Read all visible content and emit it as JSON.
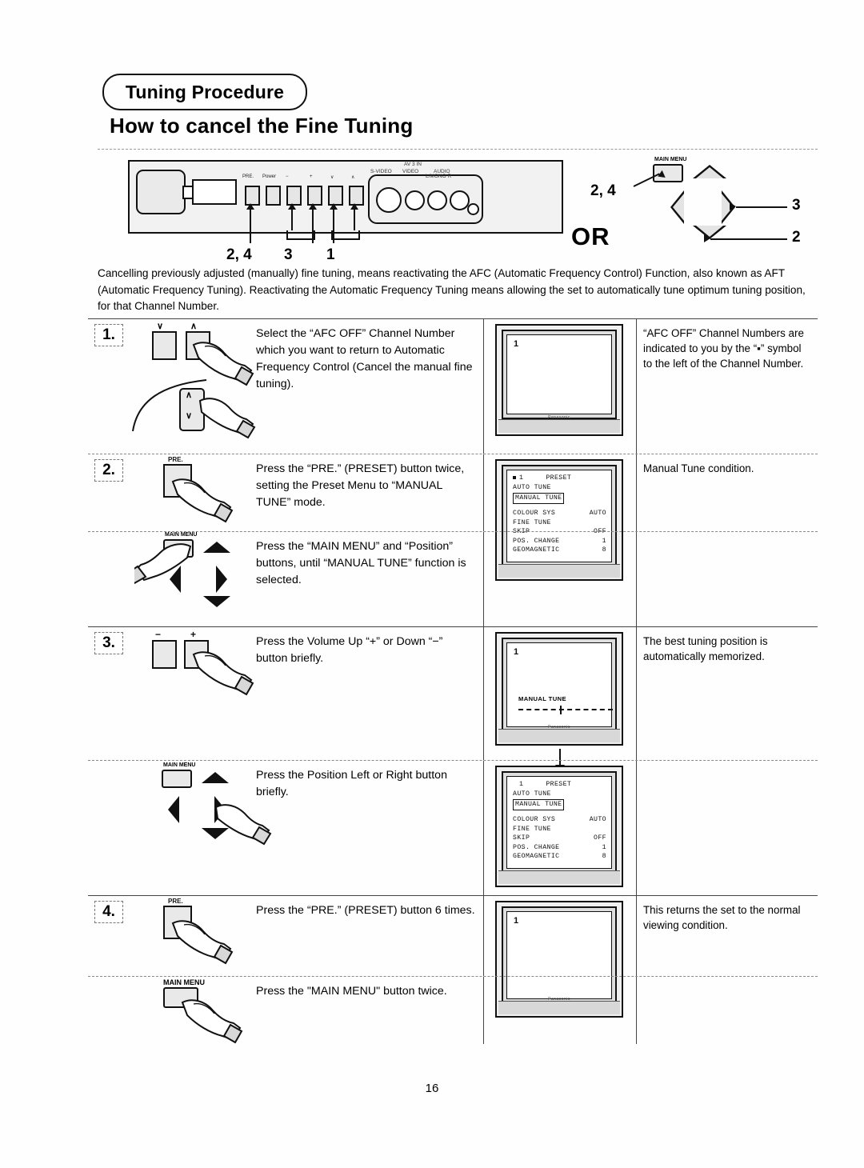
{
  "header": {
    "badge": "Tuning Procedure",
    "title": "How to cancel the Fine Tuning"
  },
  "intro": "Cancelling previously adjusted (manually) fine tuning, means reactivating the AFC (Automatic Frequency Control) Function, also known as AFT (Automatic Frequency Tuning). Reactivating the Automatic Frequency Tuning means allowing the set to automatically tune optimum tuning position, for that Channel Number.",
  "front_panel": {
    "buttons": [
      {
        "label": "PRE.",
        "callout": "2, 4"
      },
      {
        "label": "Power",
        "callout": ""
      },
      {
        "label": "−",
        "callout": "3"
      },
      {
        "label": "+",
        "callout": "3"
      },
      {
        "label": "∨",
        "callout": "1"
      },
      {
        "label": "∧",
        "callout": "1"
      }
    ],
    "callouts": [
      "2, 4",
      "3",
      "1"
    ],
    "av_labels": {
      "top": "AV 3 IN",
      "left": "S-VIDEO",
      "center": "VIDEO",
      "right": "AUDIO",
      "channels": "L/MONO  R"
    }
  },
  "remote_diagram": {
    "main_menu_label": "MAIN MENU",
    "main_menu_callout": "2, 4",
    "right_callout": "3",
    "down_callout": "2",
    "or_text": "OR"
  },
  "steps": [
    {
      "number": "1.",
      "button_labels": [
        "∨",
        "∧"
      ],
      "text": "Select the “AFC OFF” Channel Number which you want to return to Automatic Frequency Control (Cancel the manual fine tuning).",
      "note": "“AFC OFF” Channel Numbers are indicated to you by the “▪” symbol to the left of the Channel Number.",
      "tv": {
        "kind": "plain",
        "channel": "1"
      }
    },
    {
      "number": "2.",
      "button_labels": [
        "PRE."
      ],
      "text": "Press the “PRE.” (PRESET) button twice, setting the Preset Menu to “MANUAL TUNE” mode.",
      "note": "Manual Tune condition.",
      "tv": {
        "kind": "menu",
        "channel": "1",
        "afc_dot": true
      }
    },
    {
      "number": "",
      "button_labels": [
        "MAIN MENU"
      ],
      "text": "Press the “MAIN MENU” and “Position” buttons, until “MANUAL TUNE” function is selected.",
      "note": "",
      "tv": {
        "kind": "none"
      }
    },
    {
      "number": "3.",
      "button_labels": [
        "−",
        "+"
      ],
      "text": "Press the Volume Up “+” or Down “−” button briefly.",
      "note": "The best tuning position is automatically memorized.",
      "tv": {
        "kind": "manual-tune",
        "channel": "1",
        "osd_label": "MANUAL TUNE"
      }
    },
    {
      "number": "",
      "button_labels": [
        "MAIN MENU"
      ],
      "text": "Press the Position Left or Right button briefly.",
      "note": "",
      "tv": {
        "kind": "menu",
        "channel": "1",
        "afc_dot": false
      }
    },
    {
      "number": "4.",
      "button_labels": [
        "PRE."
      ],
      "text": "Press the “PRE.” (PRESET) button 6 times.",
      "note": "This returns the set to the normal viewing condition.",
      "tv": {
        "kind": "plain",
        "channel": "1"
      }
    },
    {
      "number": "",
      "button_labels": [
        "MAIN MENU"
      ],
      "text": "Press the \"MAIN MENU\" button twice.",
      "note": "",
      "tv": {
        "kind": "none"
      }
    }
  ],
  "osd_menu": {
    "title": "PRESET",
    "channel": "1",
    "items": [
      {
        "label": "AUTO TUNE",
        "value": "",
        "highlighted": false
      },
      {
        "label": "MANUAL  TUNE",
        "value": "",
        "highlighted": true
      }
    ],
    "settings": [
      {
        "label": "COLOUR SYS",
        "value": "AUTO"
      },
      {
        "label": "FINE TUNE",
        "value": ""
      },
      {
        "label": "SKIP",
        "value": "OFF"
      },
      {
        "label": "POS. CHANGE",
        "value": "1"
      },
      {
        "label": "GEOMAGNETIC",
        "value": "8"
      }
    ]
  },
  "page_number": "16"
}
